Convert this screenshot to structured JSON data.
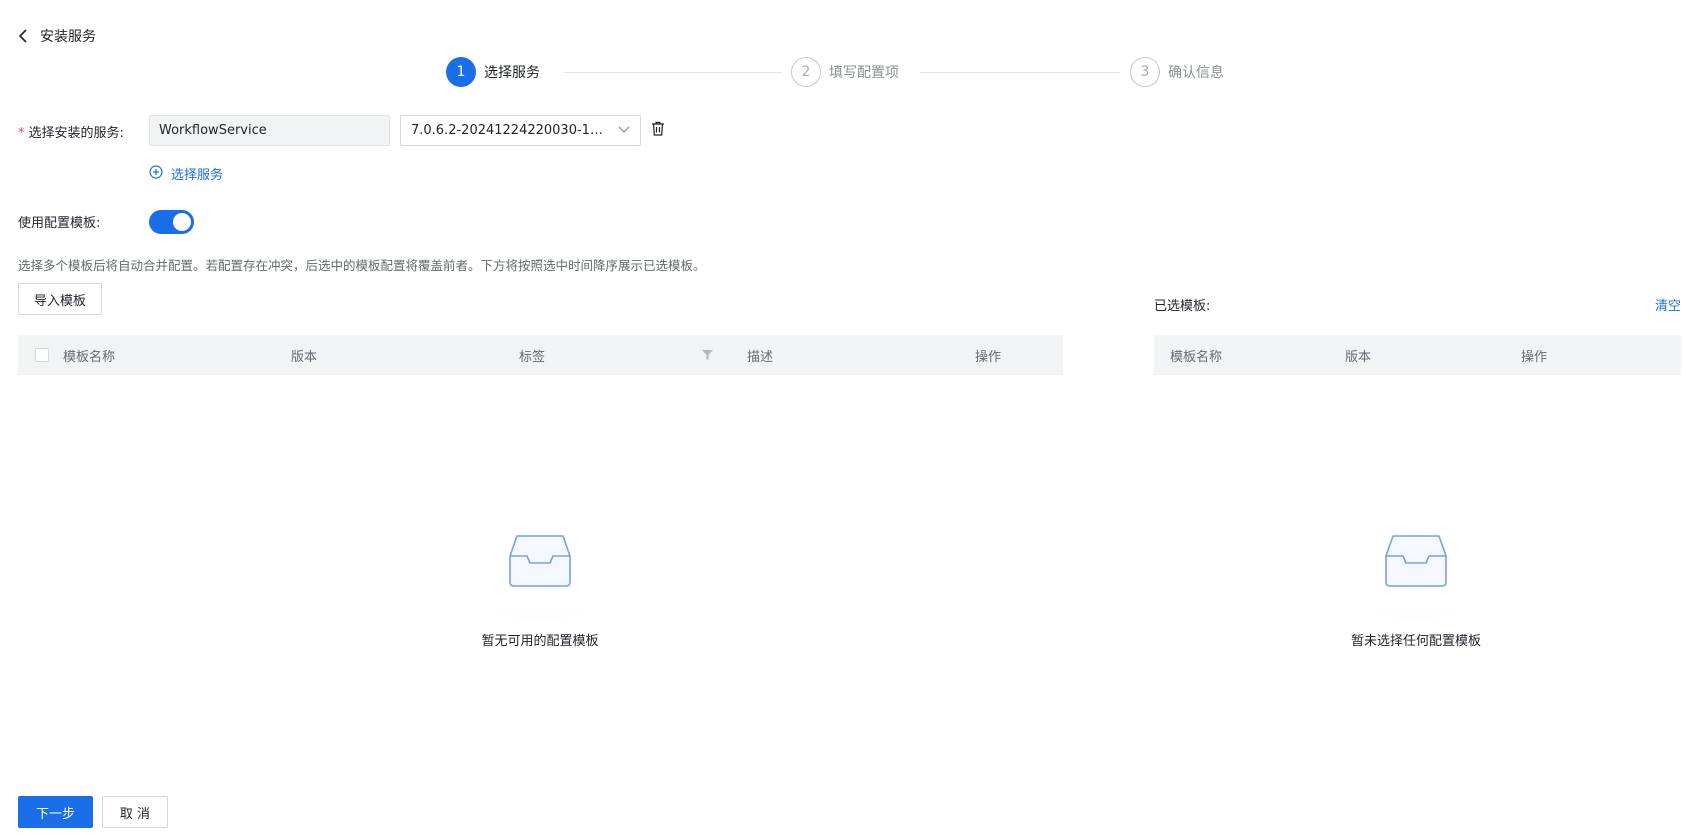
{
  "header": {
    "title": "安装服务"
  },
  "steps": [
    {
      "num": "1",
      "label": "选择服务"
    },
    {
      "num": "2",
      "label": "填写配置项"
    },
    {
      "num": "3",
      "label": "确认信息"
    }
  ],
  "form": {
    "service_required_mark": "*",
    "service_label": "选择安装的服务:",
    "service_value": "WorkflowService",
    "version_value": "7.0.6.2-20241224220030-1289...",
    "add_service_label": "选择服务",
    "template_toggle_label": "使用配置模板:",
    "template_toggle_on": true,
    "hint": "选择多个模板后将自动合并配置。若配置存在冲突，后选中的模板配置将覆盖前者。下方将按照选中时间降序展示已选模板。"
  },
  "left_panel": {
    "import_button": "导入模板",
    "columns": [
      "模板名称",
      "版本",
      "标签",
      "描述",
      "操作"
    ],
    "empty_text": "暂无可用的配置模板"
  },
  "right_panel": {
    "title": "已选模板:",
    "clear_link": "清空",
    "columns": [
      "模板名称",
      "版本",
      "操作"
    ],
    "empty_text": "暂未选择任何配置模板"
  },
  "footer": {
    "next_button": "下一步",
    "cancel_button": "取 消"
  },
  "colors": {
    "primary": "#1a6fe8",
    "header_bg": "#f2f3f5",
    "required": "#e5484d"
  }
}
